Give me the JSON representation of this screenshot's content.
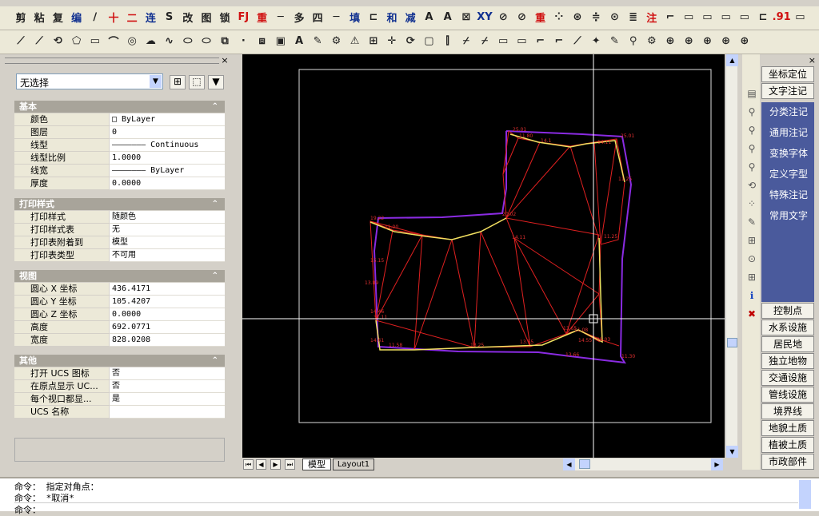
{
  "toolbar1": {
    "labels": [
      "剪",
      "粘",
      "复",
      "编",
      "∕",
      "十",
      "二",
      "连",
      "S",
      "改",
      "图",
      "锁",
      "FJ",
      "重",
      "─",
      "多",
      "四",
      "─",
      "填",
      "⊏",
      "和",
      "减",
      "A",
      "A",
      "⊠",
      "XY",
      "⊘",
      "⊘",
      "重",
      "⁘",
      "⊛",
      "≑",
      "⊙",
      "≣",
      "注",
      "⌐",
      "▭",
      "▭",
      "▭",
      "▭",
      "⊏",
      ".91",
      "▭"
    ]
  },
  "toolbar2": {
    "labels": [
      "⟋",
      "⟋",
      "⟲",
      "⬠",
      "▭",
      "⌒",
      "◎",
      "☁",
      "∿",
      "⬭",
      "⬭",
      "⧉",
      "·",
      "⧈",
      "▣",
      "A",
      "✎",
      "⚙",
      "⚠",
      "⊞",
      "✛",
      "⟳",
      "▢",
      "⫿",
      "⌿",
      "⌿",
      "▭",
      "▭",
      "⌐",
      "⌐",
      "⟋",
      "✦",
      "✎",
      "⚲",
      "⚙",
      "⊕",
      "⊕",
      "⊕",
      "⊕",
      "⊕"
    ]
  },
  "properties": {
    "selection": "无选择",
    "sections": [
      {
        "title": "基本",
        "rows": [
          {
            "k": "颜色",
            "v": "□ ByLayer"
          },
          {
            "k": "图层",
            "v": "0"
          },
          {
            "k": "线型",
            "v": "——————— Continuous"
          },
          {
            "k": "线型比例",
            "v": "1.0000"
          },
          {
            "k": "线宽",
            "v": "——————— ByLayer"
          },
          {
            "k": "厚度",
            "v": "0.0000"
          }
        ]
      },
      {
        "title": "打印样式",
        "rows": [
          {
            "k": "打印样式",
            "v": "随颜色"
          },
          {
            "k": "打印样式表",
            "v": "无"
          },
          {
            "k": "打印表附着到",
            "v": "模型"
          },
          {
            "k": "打印表类型",
            "v": "不可用"
          }
        ]
      },
      {
        "title": "视图",
        "rows": [
          {
            "k": "圆心 X 坐标",
            "v": "436.4171"
          },
          {
            "k": "圆心 Y 坐标",
            "v": "105.4207"
          },
          {
            "k": "圆心 Z 坐标",
            "v": "0.0000"
          },
          {
            "k": "高度",
            "v": "692.0771"
          },
          {
            "k": "宽度",
            "v": "828.0208"
          }
        ]
      },
      {
        "title": "其他",
        "rows": [
          {
            "k": "打开 UCS 图标",
            "v": "否"
          },
          {
            "k": "在原点显示 UC...",
            "v": "否"
          },
          {
            "k": "每个视口都显...",
            "v": "是"
          },
          {
            "k": "UCS 名称",
            "v": ""
          }
        ]
      }
    ]
  },
  "tabs": {
    "model": "模型",
    "layout": "Layout1"
  },
  "right_top_buttons": [
    "坐标定位",
    "文字注记"
  ],
  "right_text_menu": [
    "分类注记",
    "通用注记",
    "变换字体",
    "定义字型",
    "特殊注记",
    "常用文字"
  ],
  "right_bottom_buttons": [
    "控制点",
    "水系设施",
    "居民地",
    "独立地物",
    "交通设施",
    "管线设施",
    "境界线",
    "地貌土质",
    "植被土质",
    "市政部件"
  ],
  "command": {
    "line1": "命令： 指定对角点：",
    "line2": "命令： *取消*",
    "line3": "命令："
  },
  "drawing_labels": [
    "25.01",
    "11.80",
    "25.01",
    "14.1",
    "11.25",
    "14.11",
    "20.02",
    "14.11",
    "19.22",
    "11.00",
    "11.25",
    "15.15",
    "13.89",
    "31.11",
    "14.61",
    "11.58",
    "13.25",
    "13.55",
    "13.65",
    "25.03",
    "11.30",
    "14.46",
    "11.08",
    "13.66",
    "14.55"
  ]
}
